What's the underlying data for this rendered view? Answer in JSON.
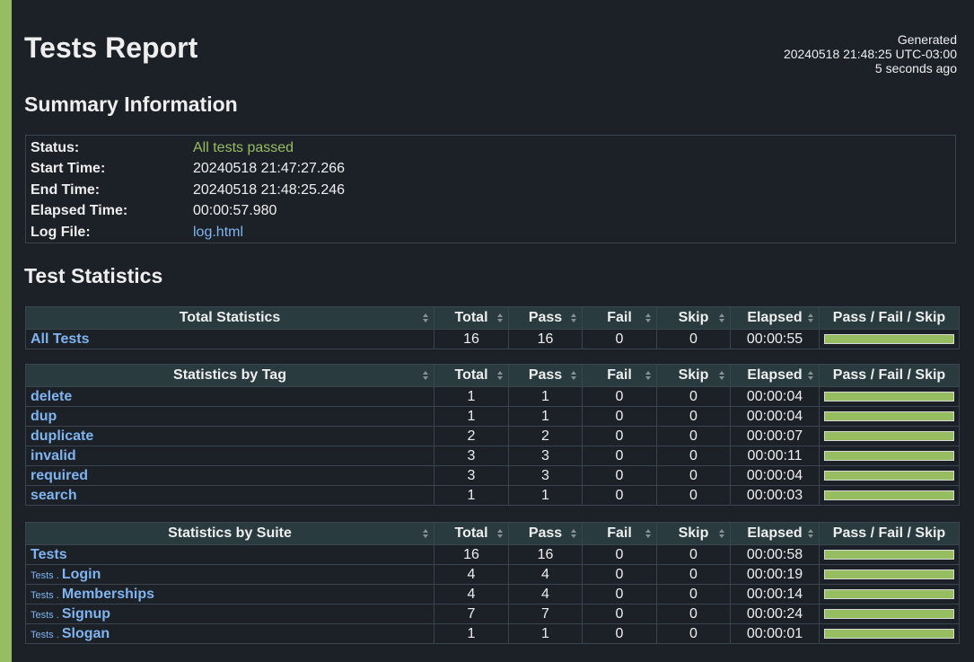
{
  "header": {
    "title": "Tests Report",
    "generated_label": "Generated",
    "generated_time": "20240518 21:48:25 UTC-03:00",
    "generated_ago": "5 seconds ago"
  },
  "summary": {
    "title": "Summary Information",
    "status_label": "Status:",
    "status_value": "All tests passed",
    "start_label": "Start Time:",
    "start_value": "20240518 21:47:27.266",
    "end_label": "End Time:",
    "end_value": "20240518 21:48:25.246",
    "elapsed_label": "Elapsed Time:",
    "elapsed_value": "00:00:57.980",
    "log_label": "Log File:",
    "log_value": "log.html"
  },
  "statistics": {
    "title": "Test Statistics",
    "columns": {
      "total": "Total",
      "pass": "Pass",
      "fail": "Fail",
      "skip": "Skip",
      "elapsed": "Elapsed",
      "graph": "Pass / Fail / Skip"
    },
    "total": {
      "header": "Total Statistics",
      "rows": [
        {
          "name": "All Tests",
          "total": "16",
          "pass": "16",
          "fail": "0",
          "skip": "0",
          "elapsed": "00:00:55"
        }
      ]
    },
    "tag": {
      "header": "Statistics by Tag",
      "rows": [
        {
          "name": "delete",
          "total": "1",
          "pass": "1",
          "fail": "0",
          "skip": "0",
          "elapsed": "00:00:04"
        },
        {
          "name": "dup",
          "total": "1",
          "pass": "1",
          "fail": "0",
          "skip": "0",
          "elapsed": "00:00:04"
        },
        {
          "name": "duplicate",
          "total": "2",
          "pass": "2",
          "fail": "0",
          "skip": "0",
          "elapsed": "00:00:07"
        },
        {
          "name": "invalid",
          "total": "3",
          "pass": "3",
          "fail": "0",
          "skip": "0",
          "elapsed": "00:00:11"
        },
        {
          "name": "required",
          "total": "3",
          "pass": "3",
          "fail": "0",
          "skip": "0",
          "elapsed": "00:00:04"
        },
        {
          "name": "search",
          "total": "1",
          "pass": "1",
          "fail": "0",
          "skip": "0",
          "elapsed": "00:00:03"
        }
      ]
    },
    "suite": {
      "header": "Statistics by Suite",
      "rows": [
        {
          "parent": "",
          "name": "Tests",
          "total": "16",
          "pass": "16",
          "fail": "0",
          "skip": "0",
          "elapsed": "00:00:58"
        },
        {
          "parent": "Tests . ",
          "name": "Login",
          "total": "4",
          "pass": "4",
          "fail": "0",
          "skip": "0",
          "elapsed": "00:00:19"
        },
        {
          "parent": "Tests . ",
          "name": "Memberships",
          "total": "4",
          "pass": "4",
          "fail": "0",
          "skip": "0",
          "elapsed": "00:00:14"
        },
        {
          "parent": "Tests . ",
          "name": "Signup",
          "total": "7",
          "pass": "7",
          "fail": "0",
          "skip": "0",
          "elapsed": "00:00:24"
        },
        {
          "parent": "Tests . ",
          "name": "Slogan",
          "total": "1",
          "pass": "1",
          "fail": "0",
          "skip": "0",
          "elapsed": "00:00:01"
        }
      ]
    }
  },
  "colors": {
    "pass": "#97bd61",
    "background": "#1c2128",
    "link": "#7fb4f0",
    "header_bg": "#2a3b3f"
  }
}
